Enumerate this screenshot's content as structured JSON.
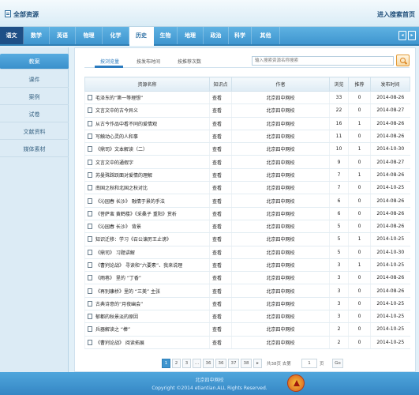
{
  "header": {
    "title": "全部资源",
    "portal_link": "进入搜索首页"
  },
  "subjects": [
    "语文",
    "数学",
    "英语",
    "物理",
    "化学",
    "历史",
    "生物",
    "地理",
    "政治",
    "科学",
    "其他"
  ],
  "sidebar": {
    "items": [
      "教案",
      "课件",
      "案例",
      "试卷",
      "文献资料",
      "媒体素材"
    ]
  },
  "subtabs": [
    "按浏览量",
    "按发布时间",
    "按推荐次数"
  ],
  "search": {
    "placeholder": "输入搜索资源名称搜索"
  },
  "table": {
    "headers": [
      "资源名称",
      "知识点",
      "作者",
      "浏览",
      "推荐",
      "发布时间"
    ],
    "rows": [
      [
        "毛泽东的“第一等理想”",
        "查看",
        "北京四中网校",
        "33",
        "0",
        "2014-08-26"
      ],
      [
        "文言文中的古今异义",
        "查看",
        "北京四中网校",
        "22",
        "0",
        "2014-08-27"
      ],
      [
        "从古今作品中看不同的爱情观",
        "查看",
        "北京四中网校",
        "16",
        "1",
        "2014-08-26"
      ],
      [
        "写触动心灵的人和事",
        "查看",
        "北京四中网校",
        "11",
        "0",
        "2014-08-26"
      ],
      [
        "《鼎司》文本解读（二）",
        "查看",
        "北京四中网校",
        "10",
        "1",
        "2014-10-30"
      ],
      [
        "文言文中的通假字",
        "查看",
        "北京四中网校",
        "9",
        "0",
        "2014-08-27"
      ],
      [
        "苏曼殊踩跃面对爱情的理解",
        "查看",
        "北京四中网校",
        "7",
        "1",
        "2014-08-26"
      ],
      [
        "南国之秋和北国之秋对比",
        "查看",
        "北京四中网校",
        "7",
        "0",
        "2014-10-25"
      ],
      [
        "《沁园春 长沙》 融情于景的手法",
        "查看",
        "北京四中网校",
        "6",
        "0",
        "2014-08-26"
      ],
      [
        "《菩萨蛮 黄鹤楼》《采桑子 重阳》赏析",
        "查看",
        "北京四中网校",
        "6",
        "0",
        "2014-08-26"
      ],
      [
        "《沁园春 长沙》 背景",
        "查看",
        "北京四中网校",
        "5",
        "0",
        "2014-08-26"
      ],
      [
        "知识迁移：学习《召公谏厉王止谤》",
        "查看",
        "北京四中网校",
        "5",
        "1",
        "2014-10-25"
      ],
      [
        "《鼎司》 习题讲解",
        "查看",
        "北京四中网校",
        "5",
        "0",
        "2014-10-30"
      ],
      [
        "《曹刿论战》 寻读和“六要素”、我来说理",
        "查看",
        "北京四中网校",
        "3",
        "1",
        "2014-10-25"
      ],
      [
        "《雨巷》 里的 “丁香”",
        "查看",
        "北京四中网校",
        "3",
        "0",
        "2014-08-26"
      ],
      [
        "《再别康桥》里的 “三美” 主张",
        "查看",
        "北京四中网校",
        "3",
        "0",
        "2014-08-26"
      ],
      [
        "古典诗意的“月夜幽会”",
        "查看",
        "北京四中网校",
        "3",
        "0",
        "2014-10-25"
      ],
      [
        "郁都的秋景淡的原因",
        "查看",
        "北京四中网校",
        "3",
        "0",
        "2014-10-25"
      ],
      [
        "兵器解读之 “棒”",
        "查看",
        "北京四中网校",
        "2",
        "0",
        "2014-10-25"
      ],
      [
        "《曹刿论战》 阅读拓展",
        "查看",
        "北京四中网校",
        "2",
        "0",
        "2014-10-25"
      ]
    ]
  },
  "pager": {
    "pages": [
      "1",
      "2",
      "3",
      "…",
      "36",
      "36",
      "37",
      "38"
    ],
    "next": "▸",
    "total_text": "共38页 去第",
    "page_input": "1",
    "page_suffix": "页",
    "go": "Go"
  },
  "footer": {
    "school": "北京四中网校",
    "copyright": "Copyright ©2014 etiantian.ALL Rights Reserved."
  },
  "colors": {
    "nav_blue": "#4aa3dc",
    "active_tab": "#2b6ea3",
    "footer_blue": "#3f95cf"
  }
}
